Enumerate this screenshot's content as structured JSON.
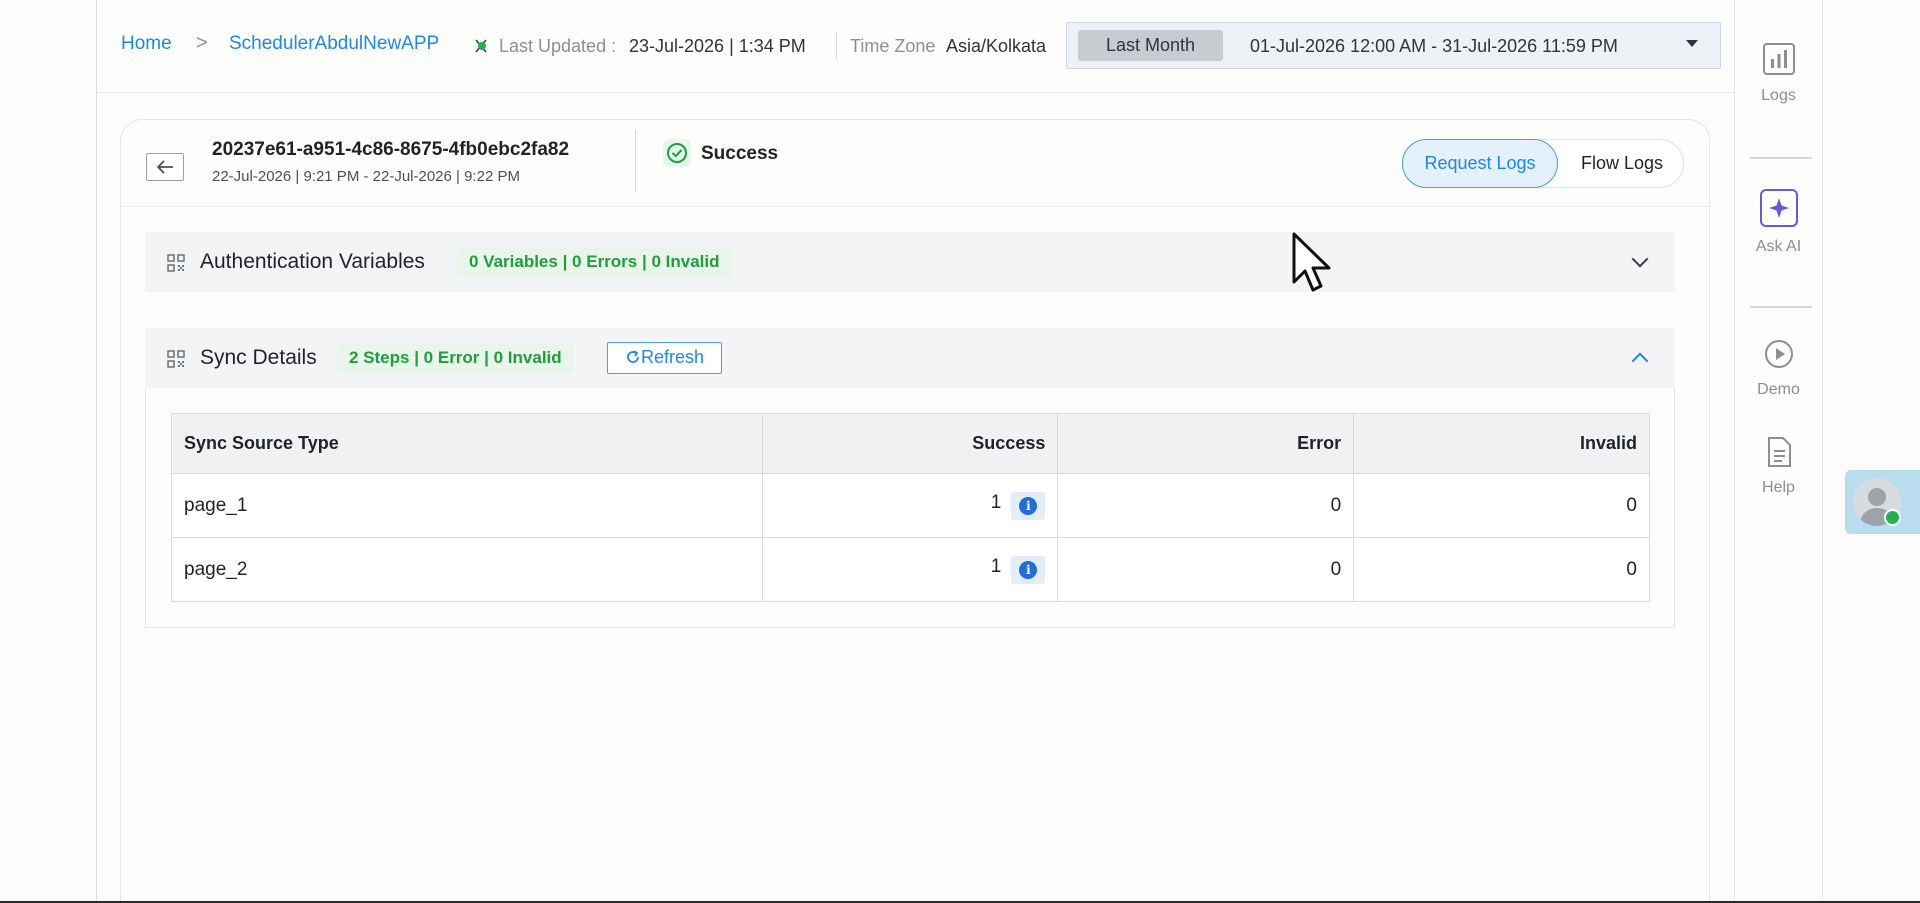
{
  "breadcrumb": {
    "home": "Home",
    "separator": ">",
    "app": "SchedulerAbdulNewAPP"
  },
  "status_bar": {
    "last_updated_label": "Last Updated :",
    "last_updated_value": "23-Jul-2026 | 1:34 PM",
    "timezone_label": "Time Zone",
    "timezone_value": "Asia/Kolkata"
  },
  "date_range": {
    "preset": "Last Month",
    "range": "01-Jul-2026 12:00 AM - 31-Jul-2026 11:59 PM"
  },
  "rail": {
    "logs": "Logs",
    "ask_ai": "Ask AI",
    "demo": "Demo",
    "help": "Help"
  },
  "request": {
    "id": "20237e61-a951-4c86-8675-4fb0ebc2fa82",
    "time": "22-Jul-2026 | 9:21 PM - 22-Jul-2026 | 9:22 PM",
    "status": "Success"
  },
  "toggle": {
    "request_logs": "Request Logs",
    "flow_logs": "Flow Logs",
    "active": "Request Logs"
  },
  "auth_section": {
    "title": "Authentication Variables",
    "badge": "0 Variables | 0 Errors | 0 Invalid",
    "expanded": false
  },
  "sync_section": {
    "title": "Sync Details",
    "badge": "2 Steps | 0 Error | 0 Invalid",
    "refresh_label": "Refresh",
    "expanded": true,
    "columns": [
      "Sync Source Type",
      "Success",
      "Error",
      "Invalid"
    ],
    "rows": [
      {
        "source": "page_1",
        "success": "1",
        "error": "0",
        "invalid": "0"
      },
      {
        "source": "page_2",
        "success": "1",
        "error": "0",
        "invalid": "0"
      }
    ]
  },
  "colors": {
    "accent": "#1e88e5",
    "success_green": "#1e9e3c",
    "ai_purple": "#6b57d6"
  }
}
